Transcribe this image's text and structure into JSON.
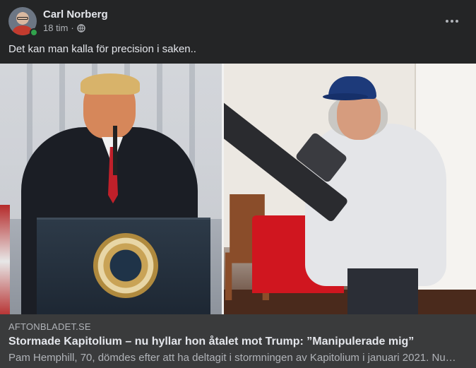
{
  "post": {
    "author_name": "Carl Norberg",
    "timestamp": "18 tim",
    "separator": "·",
    "privacy_icon": "globe-icon",
    "online_status_color": "#31a24c",
    "more_icon": "more-horizontal-icon",
    "text": "Det kan man kalla för precision i saken.."
  },
  "link_preview": {
    "source": "AFTONBLADET.SE",
    "title": "Stormade Kapitolium – nu hyllar hon åtalet mot Trump: ”Manipulerade mig”",
    "description": "Pam Hemphill, 70, dömdes efter att ha deltagit i stormningen av Kapitolium i januari 2021. Nu…"
  },
  "colors": {
    "background": "#242526",
    "link_panel": "#3a3b3c",
    "primary_text": "#e4e6eb",
    "secondary_text": "#b0b3b8"
  }
}
